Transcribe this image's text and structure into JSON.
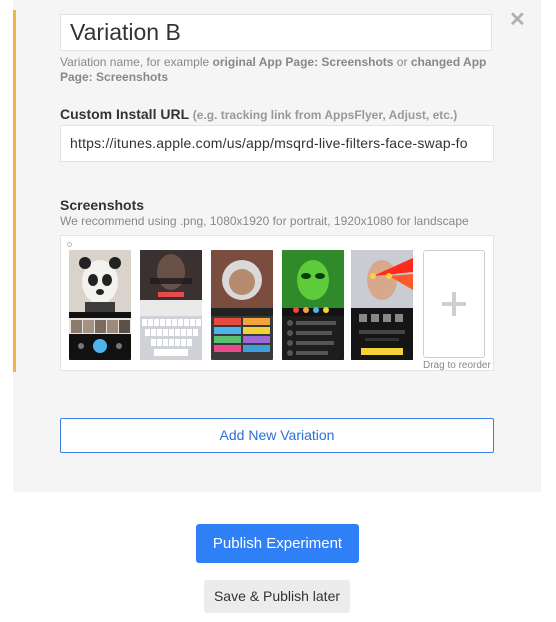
{
  "variation": {
    "name_value": "Variation B",
    "close_icon": "close-icon",
    "help_prefix": "Variation name, for example ",
    "help_example1": "original App Page: Screenshots",
    "help_or": " or ",
    "help_example2": "changed App Page: Screenshots"
  },
  "install_url": {
    "label": "Custom Install URL",
    "hint": "(e.g. tracking link from AppsFlyer, Adjust, etc.)",
    "value": "https://itunes.apple.com/us/app/msqrd-live-filters-face-swap-fo"
  },
  "screenshots": {
    "label": "Screenshots",
    "subtitle": "We recommend using .png, 1080x1920 for portrait, 1920x1080 for landscape",
    "items": [
      {
        "name": "screenshot-1",
        "theme": "panda mask selfie"
      },
      {
        "name": "screenshot-2",
        "theme": "keyboard share screen"
      },
      {
        "name": "screenshot-3",
        "theme": "astronaut mask"
      },
      {
        "name": "screenshot-4",
        "theme": "green alien"
      },
      {
        "name": "screenshot-5",
        "theme": "laser eyes"
      }
    ],
    "add_icon": "plus-icon",
    "drag_hint": "Drag to reorder"
  },
  "actions": {
    "add_variation": "Add New Variation",
    "publish": "Publish Experiment",
    "publish_later": "Save & Publish later"
  },
  "colors": {
    "accent": "#f0b44a",
    "primary": "#2f80f7",
    "link": "#2a6ed6"
  }
}
